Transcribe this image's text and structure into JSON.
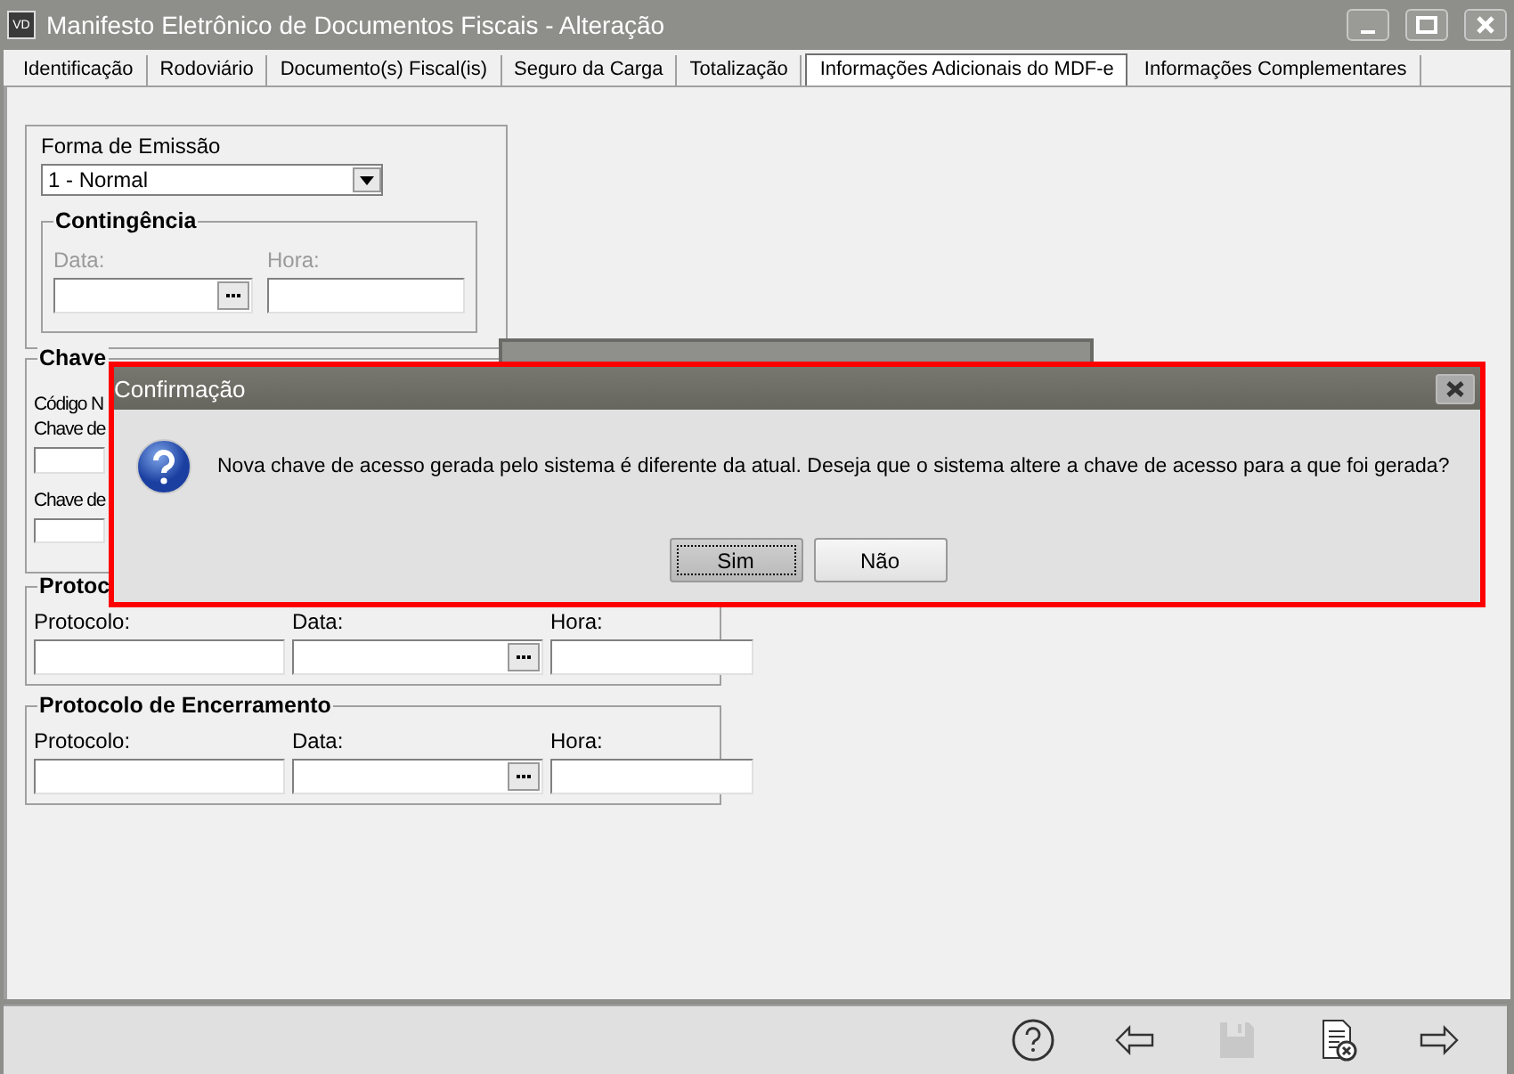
{
  "window": {
    "title": "Manifesto Eletrônico de Documentos Fiscais - Alteração",
    "badge": "VD"
  },
  "tabs": [
    {
      "label": "Identificação",
      "selected": false
    },
    {
      "label": "Rodoviário",
      "selected": false
    },
    {
      "label": "Documento(s) Fiscal(is)",
      "selected": false
    },
    {
      "label": "Seguro da Carga",
      "selected": false
    },
    {
      "label": "Totalização",
      "selected": false
    },
    {
      "label": "Informações Adicionais do MDF-e",
      "selected": true
    },
    {
      "label": "Informações Complementares",
      "selected": false
    }
  ],
  "emissao": {
    "label": "Forma de Emissão",
    "value": "1 - Normal"
  },
  "contingencia": {
    "title": "Contingência",
    "disabled": true,
    "fields": [
      {
        "label": "Data:",
        "kind": "date"
      },
      {
        "label": "Hora:",
        "kind": "text"
      }
    ]
  },
  "chave": {
    "title": "Chave",
    "items": [
      {
        "label": "Código N",
        "kind": "label"
      },
      {
        "label": "Chave de",
        "kind": "field"
      },
      {
        "label": "Chave de",
        "kind": "field"
      }
    ]
  },
  "protocolo_autorizacao": {
    "title": "Protoc",
    "fields": [
      {
        "label": "Protocolo:",
        "kind": "text"
      },
      {
        "label": "Data:",
        "kind": "date"
      },
      {
        "label": "Hora:",
        "kind": "text"
      }
    ]
  },
  "protocolo_encerramento": {
    "title": "Protocolo de Encerramento",
    "fields": [
      {
        "label": "Protocolo:",
        "kind": "text"
      },
      {
        "label": "Data:",
        "kind": "date"
      },
      {
        "label": "Hora:",
        "kind": "text"
      }
    ]
  },
  "toolbar": [
    {
      "kind": "help",
      "disabled": false
    },
    {
      "kind": "back",
      "disabled": false
    },
    {
      "kind": "save",
      "disabled": true
    },
    {
      "kind": "cancel",
      "disabled": false
    },
    {
      "kind": "next",
      "disabled": false
    }
  ],
  "dialog": {
    "title": "Confirmação",
    "message": "Nova chave de acesso gerada pelo sistema é diferente da atual. Deseja que o sistema altere a chave de acesso para a que foi gerada?",
    "buttons": [
      {
        "label": "Sim",
        "selected": true
      },
      {
        "label": "Não",
        "selected": false
      }
    ]
  }
}
